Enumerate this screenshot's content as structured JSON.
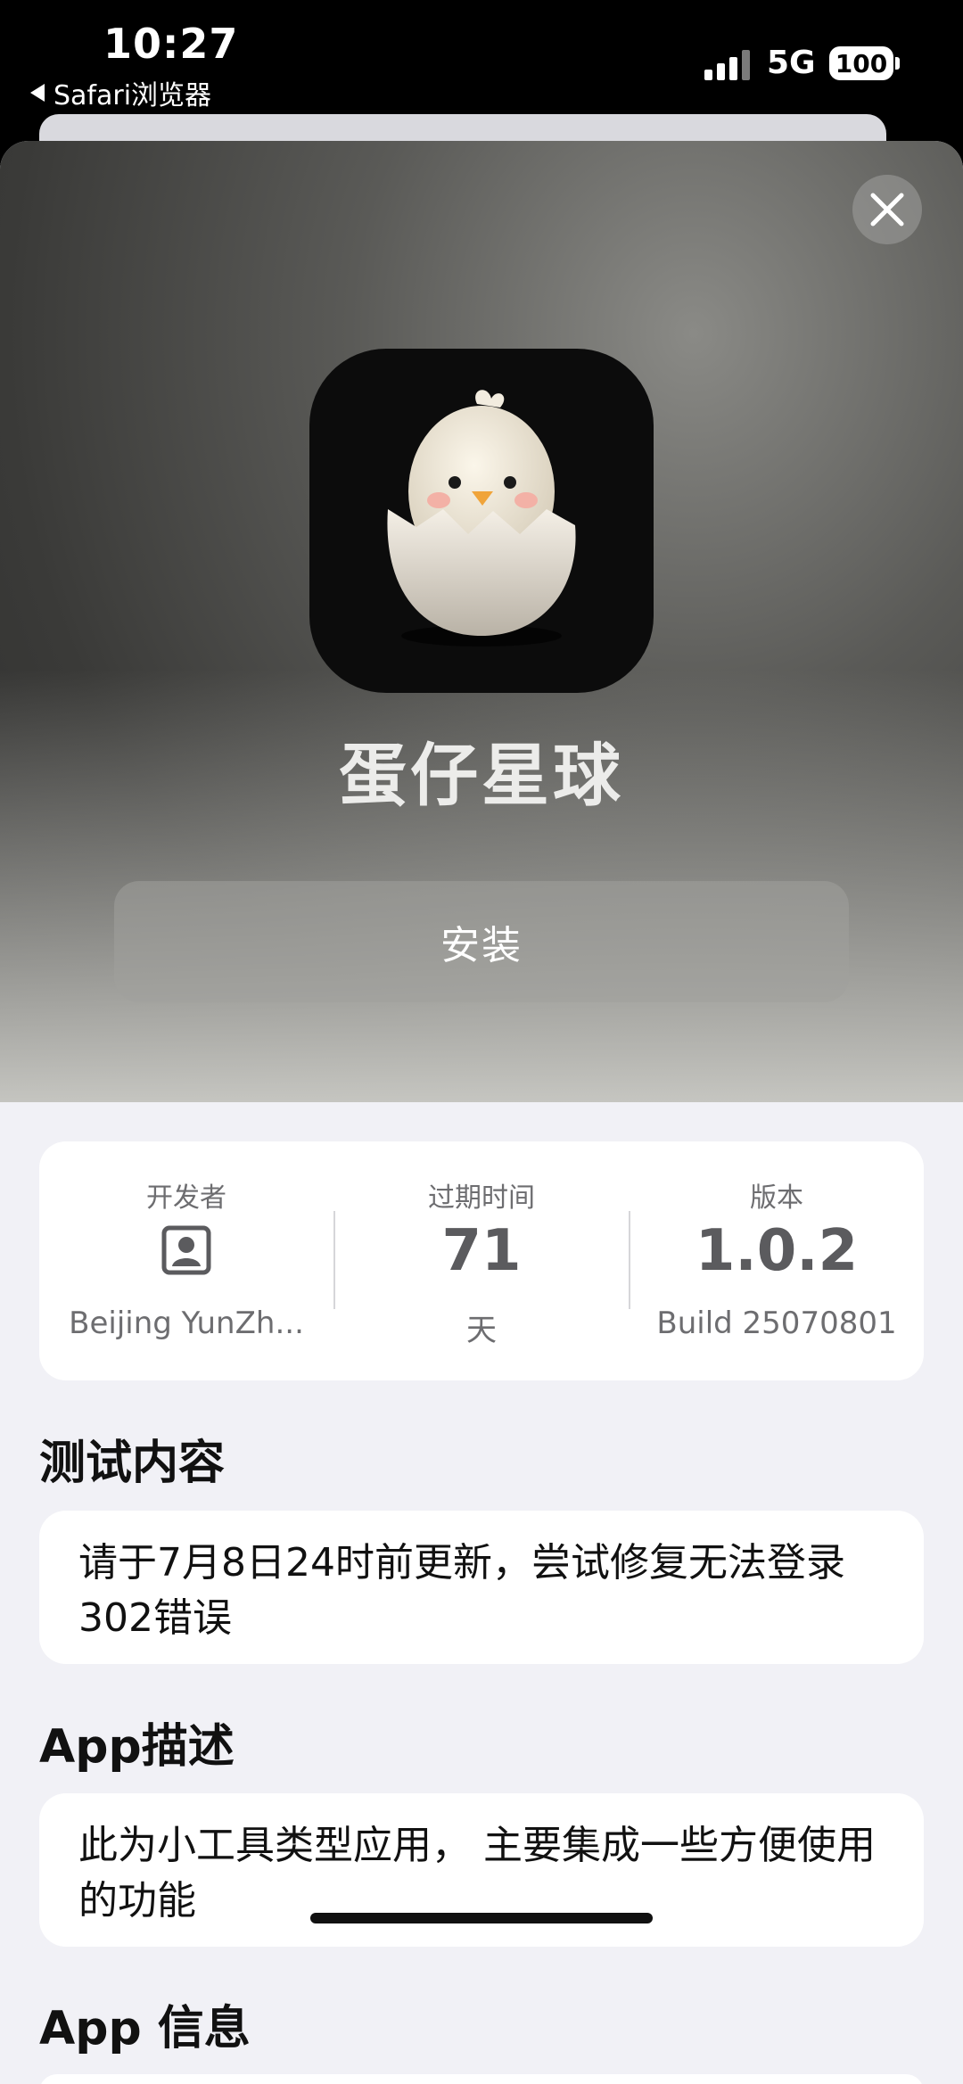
{
  "status_bar": {
    "time": "10:27",
    "back_label": "Safari浏览器",
    "network": "5G",
    "battery": "100"
  },
  "app": {
    "name": "蛋仔星球",
    "install_label": "安装"
  },
  "info": {
    "developer": {
      "label": "开发者",
      "value": "Beijing YunZh..."
    },
    "expiry": {
      "label": "过期时间",
      "value": "71",
      "unit": "天"
    },
    "version": {
      "label": "版本",
      "value": "1.0.2",
      "build": "Build 25070801"
    }
  },
  "sections": {
    "test_title": "测试内容",
    "test_content": "请于7月8日24时前更新，尝试修复无法登录302错误",
    "desc_title": "App描述",
    "desc_content": "此为小工具类型应用， 主要集成一些方便使用的功能",
    "info_title": "App 信息"
  },
  "colors": {
    "sheet_bg": "#f1f1f6",
    "card_bg": "#ffffff",
    "hero_dark": "#2e2e2d",
    "hero_light": "#cdcdc8"
  },
  "icons": [
    "signal-icon",
    "close-icon",
    "person-icon",
    "chick-egg-icon"
  ]
}
